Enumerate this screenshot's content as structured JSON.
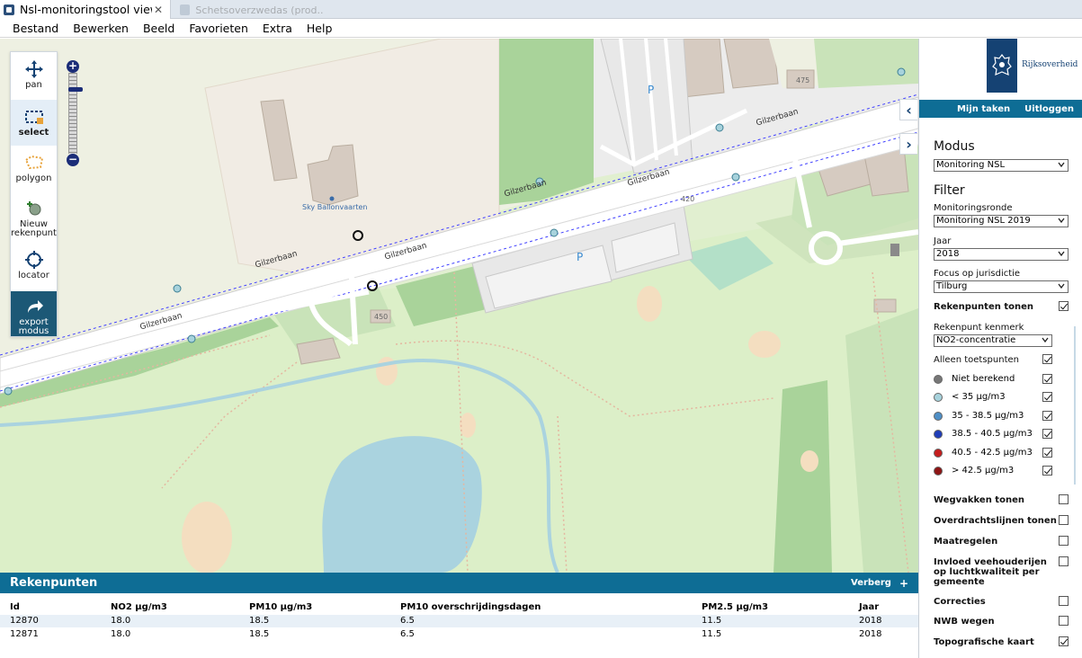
{
  "browser": {
    "active_tab": "Nsl-monitoringstool viewer",
    "close_glyph": "✕",
    "inactive_tab": "Schetsoverzwedas (prod...)"
  },
  "menu": [
    "Bestand",
    "Bewerken",
    "Beeld",
    "Favorieten",
    "Extra",
    "Help"
  ],
  "tools": [
    {
      "label": "pan",
      "icon": "move-arrows-icon"
    },
    {
      "label": "select",
      "icon": "select-rectangle-icon",
      "selected": true
    },
    {
      "label": "polygon",
      "icon": "polygon-icon"
    },
    {
      "label": "Nieuw rekenpunt",
      "icon": "new-point-icon"
    },
    {
      "label": "locator",
      "icon": "crosshair-icon"
    },
    {
      "label": "export modus",
      "icon": "export-arrow-icon"
    }
  ],
  "zoom": {
    "plus": "+",
    "minus": "−"
  },
  "map_labels": {
    "road_1": "Gilzerbaan",
    "road_2": "Gilzerbaan",
    "road_3": "Gilzerbaan",
    "road_4": "Gilzerbaan",
    "road_5": "Gilzerbaan",
    "road_6": "Gilzerbaan",
    "poi": "Sky Ballonvaarten",
    "parking_1": "P",
    "parking_2": "P",
    "house_475": "475",
    "house_450": "450",
    "house_420": "420"
  },
  "panel": {
    "logo_text": "Rijksoverheid",
    "nav_tasks": "Mijn taken",
    "nav_logout": "Uitloggen",
    "modus_heading": "Modus",
    "modus_value": "Monitoring NSL",
    "filter_heading": "Filter",
    "ronde_label": "Monitoringsronde",
    "ronde_value": "Monitoring NSL 2019",
    "jaar_label": "Jaar",
    "jaar_value": "2018",
    "focus_label": "Focus op jurisdictie",
    "focus_value": "Tilburg",
    "rekenpunten_label": "Rekenpunten tonen",
    "kenmerk_label": "Rekenpunt kenmerk",
    "kenmerk_value": "NO2-concentratie",
    "toetspunten_label": "Alleen toetspunten",
    "legend": [
      {
        "label": "Niet berekend",
        "color": "#777777"
      },
      {
        "label": "< 35 μg/m3",
        "color": "#a7d2dc"
      },
      {
        "label": "35 - 38.5 μg/m3",
        "color": "#4f8fc6"
      },
      {
        "label": "38.5 - 40.5 μg/m3",
        "color": "#1f3db8"
      },
      {
        "label": "40.5 - 42.5 μg/m3",
        "color": "#c41d1d"
      },
      {
        "label": "> 42.5 μg/m3",
        "color": "#8d1414"
      }
    ],
    "layers": [
      {
        "label": "Wegvakken tonen",
        "checked": false
      },
      {
        "label": "Overdrachtslijnen tonen",
        "checked": false
      },
      {
        "label": "Maatregelen",
        "checked": false
      },
      {
        "label": "Invloed veehouderijen op luchtkwaliteit per gemeente",
        "checked": false
      },
      {
        "label": "Correcties",
        "checked": false
      },
      {
        "label": "NWB wegen",
        "checked": false
      },
      {
        "label": "Topografische kaart",
        "checked": true
      }
    ]
  },
  "results": {
    "title": "Rekenpunten",
    "hide_label": "Verberg",
    "add_label": "+",
    "columns": [
      "Id",
      "NO2 μg/m3",
      "PM10 μg/m3",
      "PM10 overschrijdingsdagen",
      "PM2.5 μg/m3",
      "Jaar"
    ],
    "rows": [
      [
        "12870",
        "18.0",
        "18.5",
        "6.5",
        "11.5",
        "2018"
      ],
      [
        "12871",
        "18.0",
        "18.5",
        "6.5",
        "11.5",
        "2018"
      ]
    ]
  }
}
